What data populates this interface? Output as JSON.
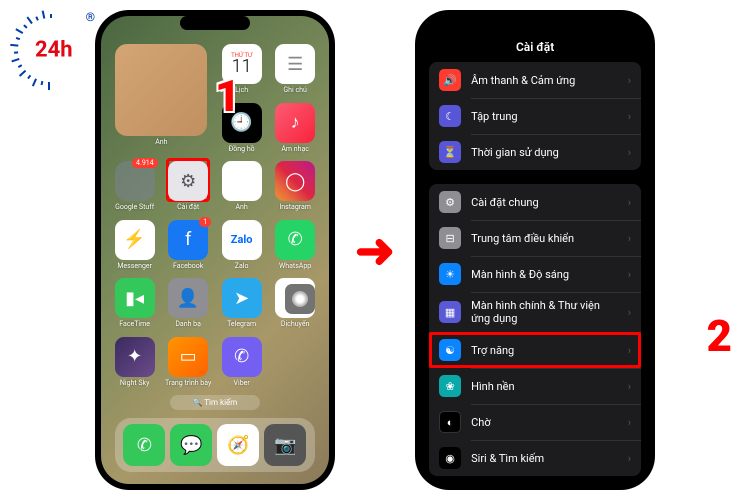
{
  "logo": {
    "text": "24h",
    "tm": "®"
  },
  "steps": {
    "one": "1",
    "two": "2"
  },
  "homescreen": {
    "widget_label": "Ảnh",
    "apps": [
      {
        "label": "Lịch",
        "day": "THỨ TƯ",
        "date": "11"
      },
      {
        "label": "Ghi chú"
      },
      {
        "label": "Đồng hồ"
      },
      {
        "label": "Âm nhạc"
      },
      {
        "label": "Google Stuff",
        "badge": "4.914"
      },
      {
        "label": "Cài đặt"
      },
      {
        "label": "Ảnh"
      },
      {
        "label": "Instagram"
      },
      {
        "label": "Messenger"
      },
      {
        "label": "Facebook",
        "badge": "1"
      },
      {
        "label": "Zalo",
        "zalo": "Zalo"
      },
      {
        "label": "WhatsApp"
      },
      {
        "label": "FaceTime"
      },
      {
        "label": "Danh bạ"
      },
      {
        "label": "Telegram"
      },
      {
        "label": "Dịchuyển"
      },
      {
        "label": "Night Sky"
      },
      {
        "label": "Trang trình bày"
      },
      {
        "label": "Viber"
      }
    ],
    "search": "Tìm kiếm"
  },
  "settings": {
    "title": "Cài đặt",
    "group1": [
      {
        "label": "Âm thanh & Cảm ứng"
      },
      {
        "label": "Tập trung"
      },
      {
        "label": "Thời gian sử dụng"
      }
    ],
    "group2": [
      {
        "label": "Cài đặt chung"
      },
      {
        "label": "Trung tâm điều khiển"
      },
      {
        "label": "Màn hình & Độ sáng"
      },
      {
        "label": "Màn hình chính & Thư viện ứng dụng"
      },
      {
        "label": "Trợ năng"
      },
      {
        "label": "Hình nền"
      },
      {
        "label": "Chờ"
      },
      {
        "label": "Siri & Tìm kiếm"
      }
    ]
  }
}
